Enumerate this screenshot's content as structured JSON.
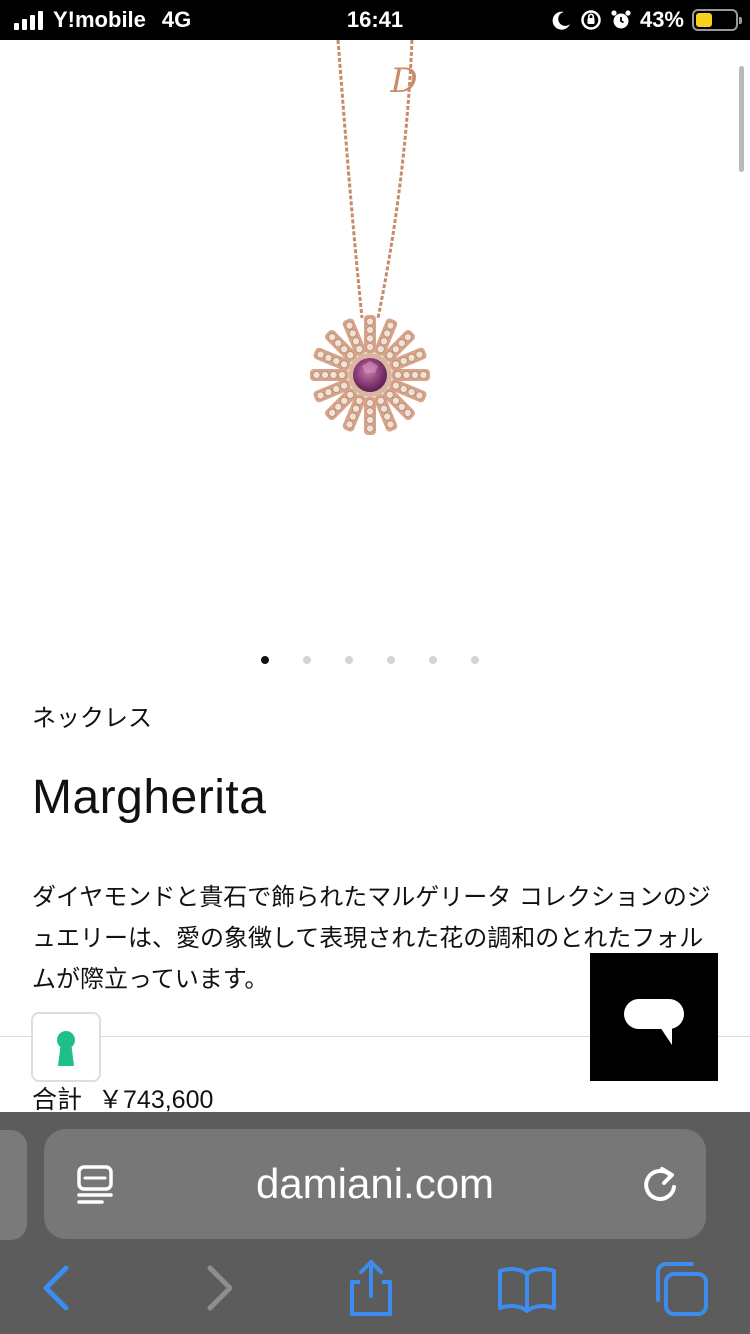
{
  "status_bar": {
    "carrier": "Y!mobile",
    "network": "4G",
    "time": "16:41",
    "battery_percent": "43%",
    "battery_level": 0.43,
    "battery_color": "#f7d21c",
    "icons": [
      "signal-icon",
      "moon-icon",
      "orientation-lock-icon",
      "alarm-icon",
      "battery-icon"
    ]
  },
  "product": {
    "image_alt": "necklace-image",
    "carousel": {
      "count": 6,
      "active_index": 0
    },
    "category": "ネックレス",
    "name": "Margherita",
    "description": "ダイヤモンドと貴石で飾られたマルゲリータ コレクションのジュエリーは、愛の象徴して表現された花の調和のとれたフォルムが際立っています。",
    "total_label": "合計",
    "total_price": "￥743,600"
  },
  "badge": {
    "icon": "keyhole-icon",
    "color": "#1fbf8c"
  },
  "chat": {
    "icon": "chat-bubble-icon"
  },
  "browser": {
    "url": "damiani.com",
    "address_bar_icons": [
      "reader-icon",
      "reload-icon"
    ],
    "toolbar": [
      "back-icon",
      "forward-icon",
      "share-icon",
      "bookmarks-icon",
      "tabs-icon"
    ],
    "accent": "#3d8cf0"
  }
}
